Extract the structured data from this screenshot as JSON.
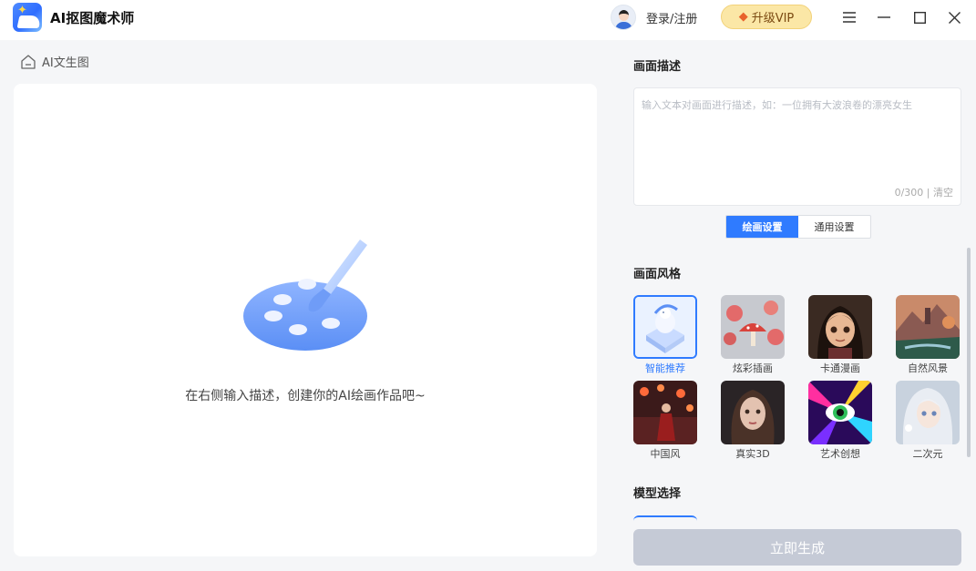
{
  "app": {
    "title": "AI抠图魔术师"
  },
  "header": {
    "login_label": "登录/注册",
    "vip_label": "升级VIP"
  },
  "breadcrumb": {
    "label": "AI文生图"
  },
  "canvas": {
    "empty_text": "在右侧输入描述，创建你的AI绘画作品吧~"
  },
  "description": {
    "title": "画面描述",
    "placeholder": "输入文本对画面进行描述，如：一位拥有大波浪卷的漂亮女生",
    "counter": "0/300",
    "separator": "|",
    "clear_label": "清空"
  },
  "settings_tabs": [
    {
      "label": "绘画设置",
      "active": true
    },
    {
      "label": "通用设置",
      "active": false
    }
  ],
  "style_section": {
    "title": "画面风格",
    "items": [
      {
        "label": "智能推荐",
        "selected": true
      },
      {
        "label": "炫彩插画",
        "selected": false
      },
      {
        "label": "卡通漫画",
        "selected": false
      },
      {
        "label": "自然风景",
        "selected": false
      },
      {
        "label": "中国风",
        "selected": false
      },
      {
        "label": "真实3D",
        "selected": false
      },
      {
        "label": "艺术创想",
        "selected": false
      },
      {
        "label": "二次元",
        "selected": false
      }
    ]
  },
  "model_section": {
    "title": "模型选择"
  },
  "generate_button": {
    "label": "立即生成"
  },
  "colors": {
    "accent": "#2f7bff",
    "disabled": "#c5cad6",
    "vip_bg": "#fbe7a6"
  }
}
